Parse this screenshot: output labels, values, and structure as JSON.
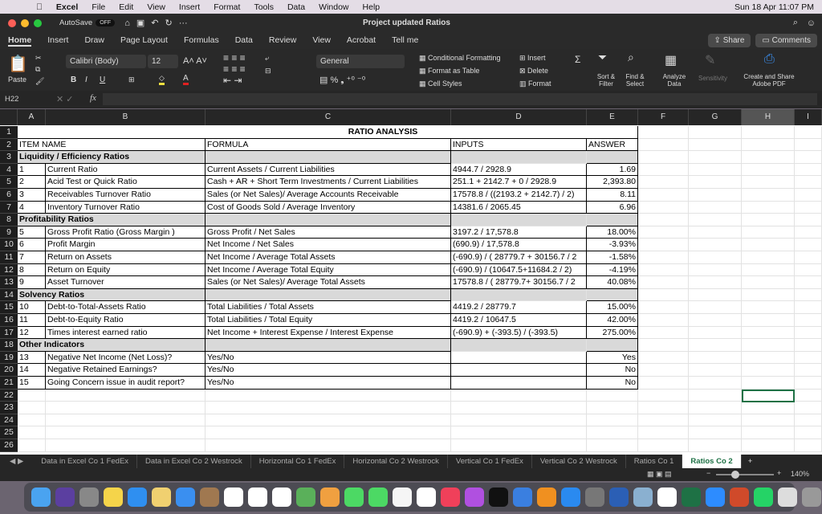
{
  "menubar": {
    "items": [
      "Excel",
      "File",
      "Edit",
      "View",
      "Insert",
      "Format",
      "Tools",
      "Data",
      "Window",
      "Help"
    ],
    "clock": "Sun 18 Apr  11:07 PM"
  },
  "titlebar": {
    "autosave": "AutoSave",
    "autosave_state": "OFF",
    "title": "Project updated Ratios"
  },
  "tabs": [
    "Home",
    "Insert",
    "Draw",
    "Page Layout",
    "Formulas",
    "Data",
    "Review",
    "View",
    "Acrobat",
    "Tell me"
  ],
  "share": "Share",
  "comments": "Comments",
  "ribbon": {
    "paste": "Paste",
    "font": "Calibri (Body)",
    "size": "12",
    "number_format": "General",
    "cond_format": "Conditional Formatting",
    "format_table": "Format as Table",
    "cell_styles": "Cell Styles",
    "insert": "Insert",
    "delete": "Delete",
    "format": "Format",
    "sort": "Sort & Filter",
    "find": "Find & Select",
    "analyze": "Analyze Data",
    "sensitivity": "Sensitivity",
    "adobe": "Create and Share Adobe PDF"
  },
  "formula_bar": {
    "name_box": "H22",
    "fx": "fx",
    "value": ""
  },
  "columns": [
    "A",
    "B",
    "C",
    "D",
    "E",
    "F",
    "G",
    "H",
    "I"
  ],
  "sheet": {
    "title": "RATIO ANALYSIS",
    "headers": {
      "item": "ITEM NAME",
      "formula": "FORMULA",
      "inputs": "INPUTS",
      "answer": "ANSWER"
    },
    "rows": [
      {
        "section": "Liquidity / Efficiency Ratios"
      },
      {
        "n": "1",
        "name": "Current Ratio",
        "formula": "Current Assets / Current Liabilities",
        "inputs": "4944.7 / 2928.9",
        "answer": "1.69"
      },
      {
        "n": "2",
        "name": "Acid Test or Quick Ratio",
        "formula": "Cash + AR + Short Term Investments / Current Liabilities",
        "inputs": "251.1 + 2142.7 + 0 / 2928.9",
        "answer": "2,393.80"
      },
      {
        "n": "3",
        "name": "Receivables Turnover Ratio",
        "formula": "Sales (or Net Sales)/ Average Accounts Receivable",
        "inputs": "17578.8 / ((2193.2 + 2142.7) / 2)",
        "answer": "8.11"
      },
      {
        "n": "4",
        "name": "Inventory Turnover Ratio",
        "formula": "Cost of Goods Sold / Average Inventory",
        "inputs": "14381.6 / 2065.45",
        "answer": "6.96"
      },
      {
        "section": "Profitability Ratios"
      },
      {
        "n": "5",
        "name": "Gross Profit Ratio (Gross Margin )",
        "formula": "Gross Profit / Net Sales",
        "inputs": "3197.2 / 17,578.8",
        "answer": "18.00%"
      },
      {
        "n": "6",
        "name": "Profit Margin",
        "formula": "Net Income / Net Sales",
        "inputs": "(690.9) / 17,578.8",
        "answer": "-3.93%"
      },
      {
        "n": "7",
        "name": "Return on Assets",
        "formula": "Net Income / Average Total Assets",
        "inputs": "(-690.9) / ( 28779.7 + 30156.7 / 2",
        "answer": "-1.58%"
      },
      {
        "n": "8",
        "name": "Return on Equity",
        "formula": "Net Income / Average Total Equity",
        "inputs": "(-690.9) / (10647.5+11684.2 / 2)",
        "answer": "-4.19%"
      },
      {
        "n": "9",
        "name": "Asset Turnover",
        "formula": "Sales (or Net Sales)/ Average Total Assets",
        "inputs": "17578.8 / ( 28779.7+ 30156.7 / 2",
        "answer": "40.08%"
      },
      {
        "section": "Solvency Ratios"
      },
      {
        "n": "10",
        "name": "Debt-to-Total-Assets Ratio",
        "formula": "Total Liabilities / Total Assets",
        "inputs": " 4419.2 / 28779.7",
        "answer": "15.00%"
      },
      {
        "n": "11",
        "name": "Debt-to-Equity Ratio",
        "formula": "Total Liabilities / Total Equity",
        "inputs": "4419.2 / 10647.5",
        "answer": "42.00%"
      },
      {
        "n": "12",
        "name": "Times interest earned ratio",
        "formula": "Net Income + Interest Expense / Interest Expense",
        "inputs": "(-690.9) + (-393.5) / (-393.5)",
        "answer": "275.00%"
      },
      {
        "section": "Other Indicators"
      },
      {
        "n": "13",
        "name": "Negative Net Income (Net Loss)?",
        "formula": "Yes/No",
        "inputs": "",
        "answer": "Yes"
      },
      {
        "n": "14",
        "name": "Negative Retained Earnings?",
        "formula": "Yes/No",
        "inputs": "",
        "answer": "No"
      },
      {
        "n": "15",
        "name": "Going Concern issue in audit report?",
        "formula": "Yes/No",
        "inputs": "",
        "answer": "No"
      }
    ]
  },
  "sheet_tabs": [
    "Data in Excel Co 1 FedEx",
    "Data in Excel Co 2 Westrock",
    "Horizontal Co 1 FedEx",
    "Horizontal Co 2 Westrock",
    "Vertical Co 1 FedEx",
    "Vertical Co 2 Westrock",
    "Ratios Co 1",
    "Ratios Co 2"
  ],
  "active_sheet": "Ratios Co 2",
  "zoom": "140%",
  "zoom_percent": 140,
  "dock_colors": [
    "#4aa3f0",
    "#5b3fa0",
    "#888",
    "#f5d44a",
    "#2f8ff0",
    "#f0d070",
    "#3a8ff0",
    "#a07850",
    "#fff",
    "#fff",
    "#fff",
    "#5ab05a",
    "#f0a040",
    "#4cd964",
    "#4cd964",
    "#f5f5f5",
    "#fff",
    "#f0405a",
    "#b050e0",
    "#111",
    "#3a7fe0",
    "#f09020",
    "#2a8af0",
    "#777",
    "#2b5fb5",
    "#8ab0d0",
    "#fff",
    "#1e7145",
    "#2d8cff",
    "#d04a2a",
    "#25d366",
    "#ddd",
    "#999"
  ]
}
